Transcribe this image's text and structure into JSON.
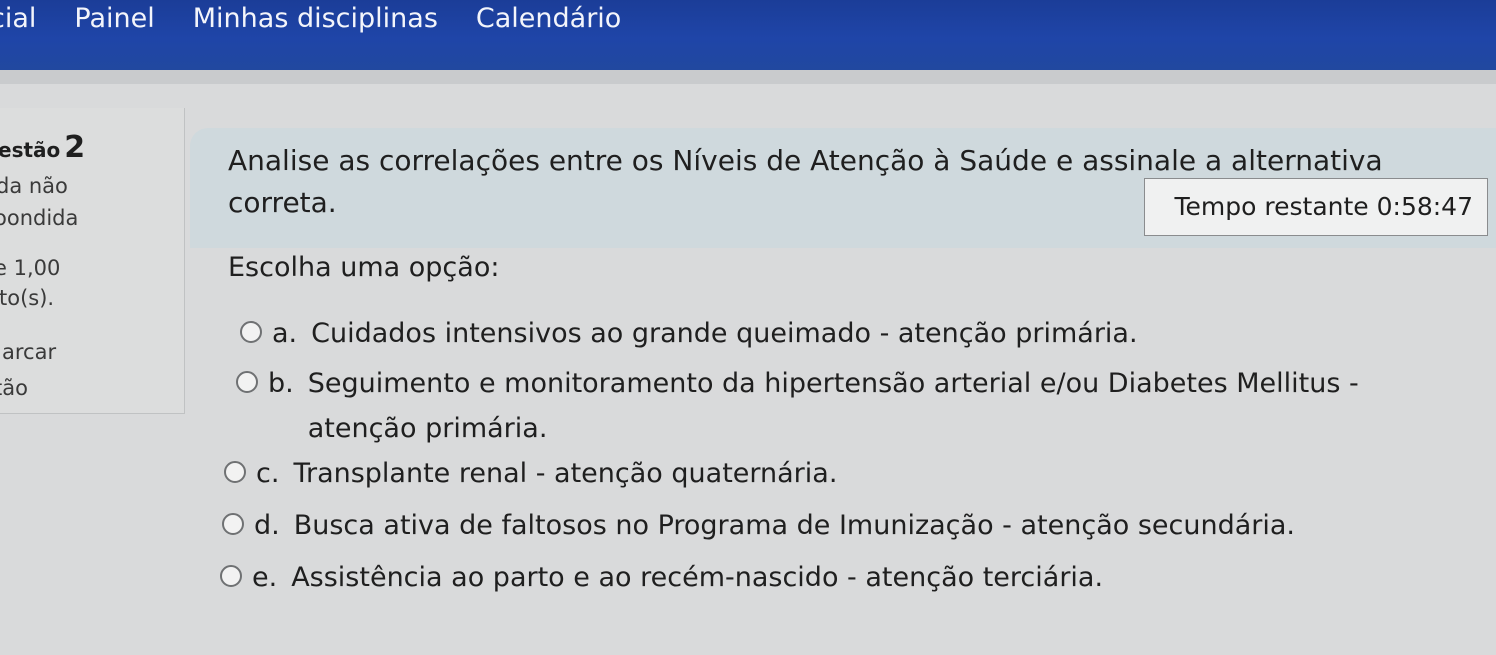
{
  "nav": {
    "items": [
      "cial",
      "Painel",
      "Minhas disciplinas",
      "Calendário"
    ]
  },
  "question_info": {
    "title_prefix": "estão",
    "number": "2",
    "status_line1": "da não",
    "status_line2": "oondida",
    "grade": "e 1,00",
    "grade_suffix": "to(s).",
    "flag_line1": "arcar",
    "flag_line2": "tão"
  },
  "question": {
    "text": "Analise as correlações entre os Níveis de Atenção à Saúde e assinale a alternativa correta.",
    "prompt": "Escolha uma opção:",
    "options": [
      {
        "letter": "a.",
        "text": "Cuidados intensivos ao grande queimado - atenção primária."
      },
      {
        "letter": "b.",
        "text": "Seguimento e monitoramento da hipertensão arterial e/ou Diabetes Mellitus - atenção primária."
      },
      {
        "letter": "c.",
        "text": "Transplante renal - atenção quaternária."
      },
      {
        "letter": "d.",
        "text": "Busca ativa de faltosos no Programa de Imunização - atenção secundária."
      },
      {
        "letter": "e.",
        "text": "Assistência ao parto e ao recém-nascido - atenção terciária."
      }
    ]
  },
  "timer": {
    "label": "Tempo restante 0:58:47"
  },
  "colors": {
    "navbar": "#1f45a8",
    "page_bg": "#d9dadb",
    "question_panel": "#cfd9dd"
  }
}
